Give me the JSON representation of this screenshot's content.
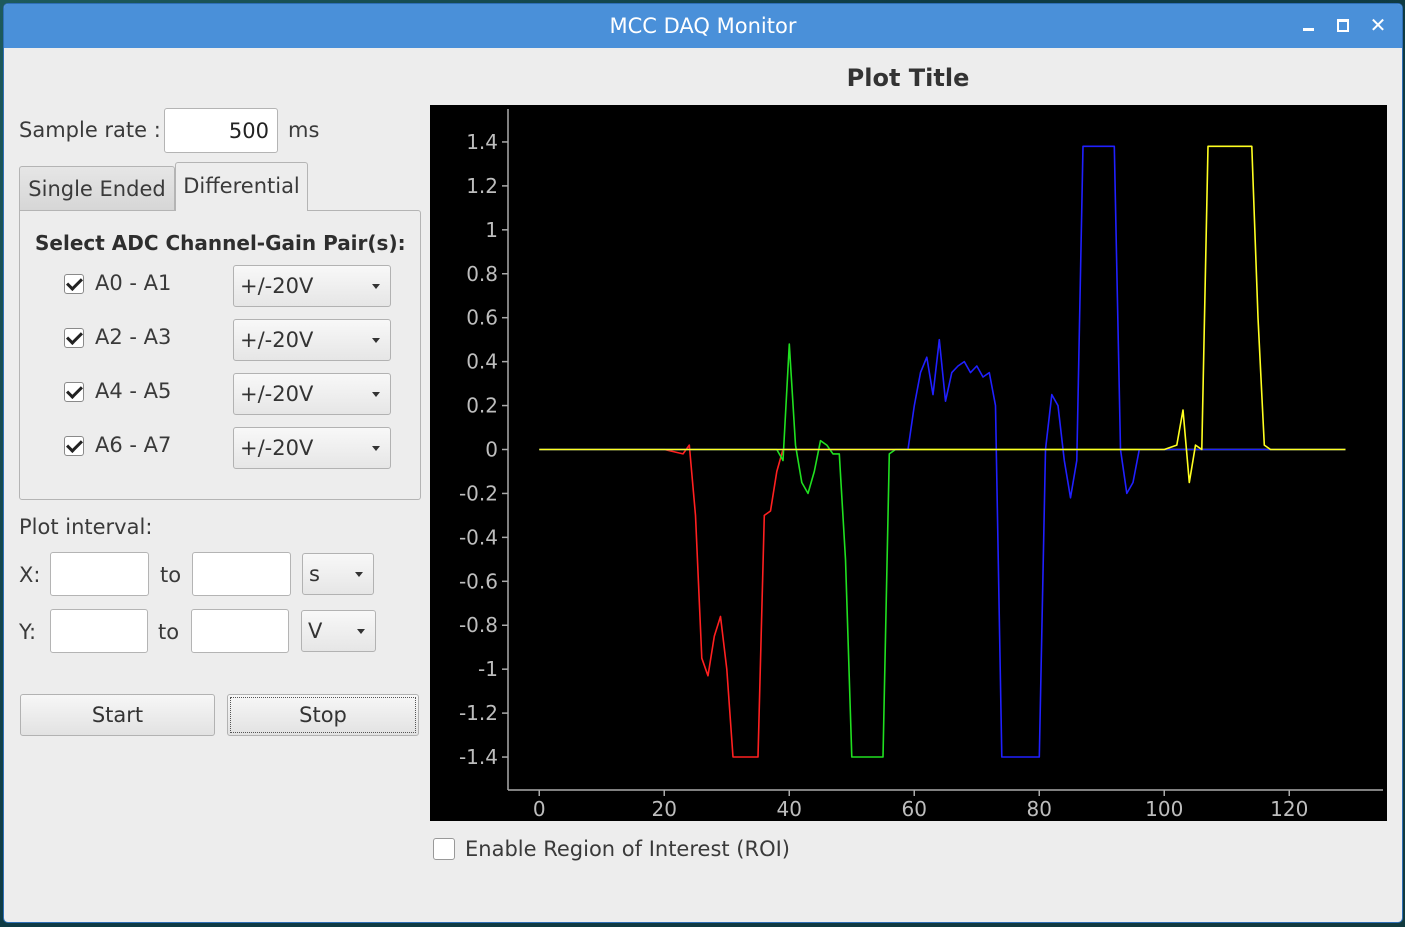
{
  "window": {
    "title": "MCC DAQ Monitor"
  },
  "sample_rate": {
    "label": "Sample rate :",
    "value": "500",
    "unit": "ms"
  },
  "tabs": [
    {
      "label": "Single Ended",
      "active": false
    },
    {
      "label": "Differential",
      "active": true
    }
  ],
  "channel_section": {
    "heading": "Select ADC Channel-Gain Pair(s):",
    "channels": [
      {
        "label": "A0 - A1",
        "checked": true,
        "gain": "+/-20V"
      },
      {
        "label": "A2 - A3",
        "checked": true,
        "gain": "+/-20V"
      },
      {
        "label": "A4 - A5",
        "checked": true,
        "gain": "+/-20V"
      },
      {
        "label": "A6 - A7",
        "checked": true,
        "gain": "+/-20V"
      }
    ]
  },
  "plot_interval": {
    "label": "Plot interval:",
    "x": {
      "label": "X:",
      "from": "",
      "to_label": "to",
      "to": "",
      "unit": "s"
    },
    "y": {
      "label": "Y:",
      "from": "",
      "to_label": "to",
      "to": "",
      "unit": "V"
    }
  },
  "buttons": {
    "start": "Start",
    "stop": "Stop"
  },
  "roi": {
    "label": "Enable Region of Interest (ROI)",
    "checked": false
  },
  "chart_data": {
    "type": "line",
    "title": "Plot Title",
    "xlabel": "",
    "ylabel": "",
    "xlim": [
      -5,
      135
    ],
    "ylim": [
      -1.55,
      1.55
    ],
    "xticks": [
      0,
      20,
      40,
      60,
      80,
      100,
      120
    ],
    "yticks": [
      1.4,
      1.2,
      1,
      0.8,
      0.6,
      0.4,
      0.2,
      0,
      -0.2,
      -0.4,
      -0.6,
      -0.8,
      -1,
      -1.2,
      -1.4
    ],
    "ytick_labels": [
      "1.4",
      "1.2",
      "1",
      "0.8",
      "0.6",
      "0.4",
      "0.2",
      "0",
      "-0.2",
      "-0.4",
      "-0.6",
      "-0.8",
      "-1",
      "-1.2",
      "-1.4"
    ],
    "background": "#000000",
    "grid": false,
    "series": [
      {
        "color": "#ff2020",
        "x": [
          0,
          10,
          20,
          23,
          24,
          25,
          26,
          27,
          28,
          29,
          30,
          31,
          32,
          34,
          35,
          36,
          37,
          38,
          39,
          40,
          50,
          60,
          80,
          100,
          129
        ],
        "y": [
          0,
          0,
          0,
          -0.02,
          0.02,
          -0.3,
          -0.95,
          -1.03,
          -0.85,
          -0.76,
          -1.0,
          -1.4,
          -1.4,
          -1.4,
          -1.4,
          -0.3,
          -0.28,
          -0.1,
          0,
          0,
          0,
          0,
          0,
          0,
          0
        ]
      },
      {
        "color": "#20e020",
        "x": [
          0,
          20,
          38,
          39,
          40,
          41,
          42,
          43,
          44,
          45,
          46,
          47,
          48,
          49,
          50,
          51,
          52,
          53,
          54,
          55,
          56,
          57,
          58,
          60,
          80,
          100,
          129
        ],
        "y": [
          0,
          0,
          0,
          -0.05,
          0.48,
          0.02,
          -0.15,
          -0.2,
          -0.1,
          0.04,
          0.02,
          -0.02,
          -0.02,
          -0.5,
          -1.4,
          -1.4,
          -1.4,
          -1.4,
          -1.4,
          -1.4,
          -0.02,
          0,
          0,
          0,
          0,
          0,
          0
        ]
      },
      {
        "color": "#2020ff",
        "x": [
          0,
          20,
          40,
          59,
          60,
          61,
          62,
          63,
          64,
          65,
          66,
          67,
          68,
          69,
          70,
          71,
          72,
          73,
          74,
          75,
          76,
          77,
          78,
          79,
          80,
          81,
          82,
          83,
          84,
          85,
          86,
          87,
          88,
          89,
          90,
          91,
          92,
          93,
          94,
          95,
          96,
          97,
          98,
          100,
          110,
          120,
          129
        ],
        "y": [
          0,
          0,
          0,
          0,
          0.2,
          0.35,
          0.42,
          0.25,
          0.5,
          0.22,
          0.35,
          0.38,
          0.4,
          0.35,
          0.38,
          0.33,
          0.35,
          0.2,
          -1.4,
          -1.4,
          -1.4,
          -1.4,
          -1.4,
          -1.4,
          -1.4,
          0.0,
          0.25,
          0.2,
          -0.05,
          -0.22,
          -0.05,
          1.38,
          1.38,
          1.38,
          1.38,
          1.38,
          1.38,
          0.0,
          -0.2,
          -0.15,
          0.0,
          0.0,
          0,
          0,
          0,
          0,
          0
        ]
      },
      {
        "color": "#ffff20",
        "x": [
          0,
          20,
          40,
          60,
          80,
          100,
          102,
          103,
          104,
          105,
          106,
          107,
          108,
          109,
          110,
          111,
          112,
          113,
          114,
          115,
          116,
          117,
          118,
          119,
          120,
          129
        ],
        "y": [
          0,
          0,
          0,
          0,
          0,
          0,
          0.02,
          0.18,
          -0.15,
          0.02,
          0.0,
          1.38,
          1.38,
          1.38,
          1.38,
          1.38,
          1.38,
          1.38,
          1.38,
          0.6,
          0.02,
          0,
          0,
          0,
          0,
          0
        ]
      }
    ]
  }
}
